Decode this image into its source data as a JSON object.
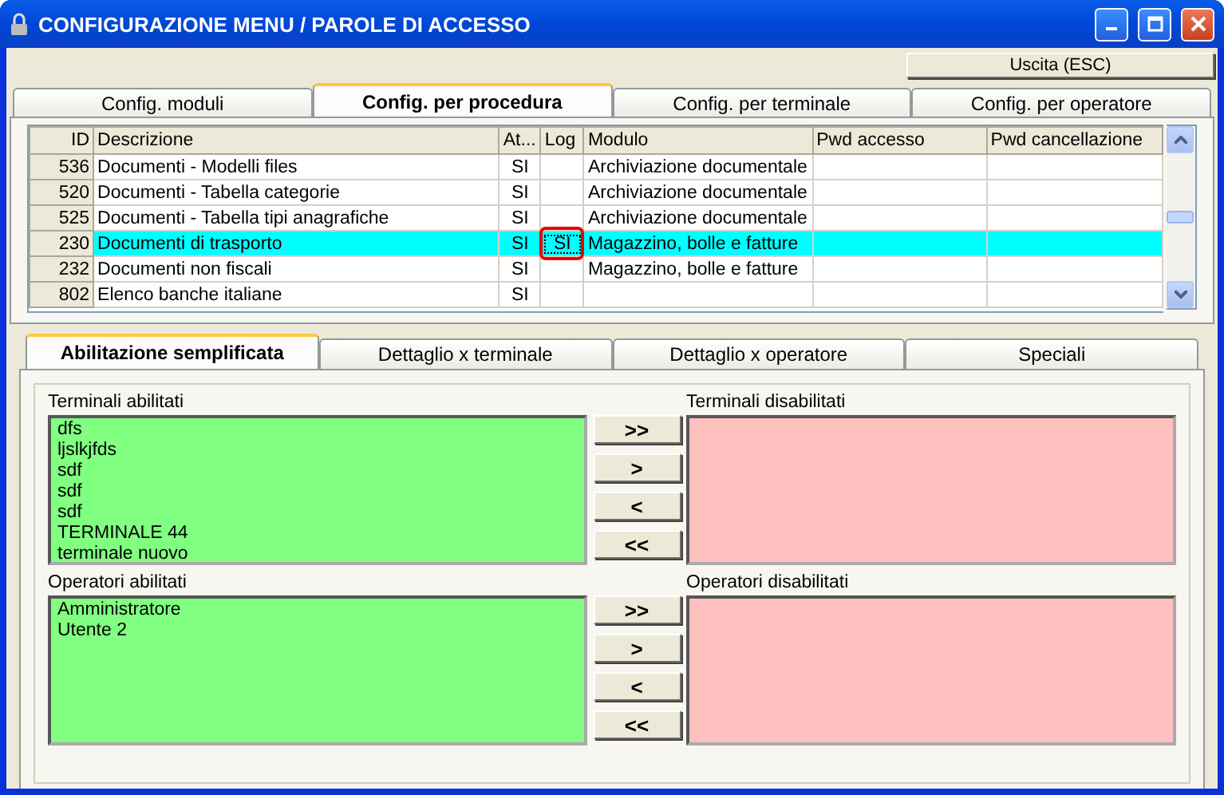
{
  "window": {
    "title": "CONFIGURAZIONE MENU / PAROLE DI ACCESSO"
  },
  "exit_button": "Uscita (ESC)",
  "tabs": [
    {
      "label": "Config. moduli",
      "selected": false
    },
    {
      "label": "Config. per procedura",
      "selected": true
    },
    {
      "label": "Config. per terminale",
      "selected": false
    },
    {
      "label": "Config. per operatore",
      "selected": false
    }
  ],
  "table": {
    "columns": [
      "ID",
      "Descrizione",
      "At...",
      "Log",
      "Modulo",
      "Pwd accesso",
      "Pwd cancellazione"
    ],
    "rows": [
      {
        "id": "536",
        "descrizione": "Documenti - Modelli files",
        "at": "SI",
        "log": "",
        "modulo": "Archiviazione documentale",
        "selected": false,
        "log_highlighted": false
      },
      {
        "id": "520",
        "descrizione": "Documenti - Tabella categorie",
        "at": "SI",
        "log": "",
        "modulo": "Archiviazione documentale",
        "selected": false,
        "log_highlighted": false
      },
      {
        "id": "525",
        "descrizione": "Documenti - Tabella tipi anagrafiche",
        "at": "SI",
        "log": "",
        "modulo": "Archiviazione documentale",
        "selected": false,
        "log_highlighted": false
      },
      {
        "id": "230",
        "descrizione": "Documenti di trasporto",
        "at": "SI",
        "log": "SI",
        "modulo": "Magazzino, bolle e fatture",
        "selected": true,
        "log_highlighted": true
      },
      {
        "id": "232",
        "descrizione": "Documenti non fiscali",
        "at": "SI",
        "log": "",
        "modulo": "Magazzino, bolle e fatture",
        "selected": false,
        "log_highlighted": false
      },
      {
        "id": "802",
        "descrizione": "Elenco banche italiane",
        "at": "SI",
        "log": "",
        "modulo": "",
        "selected": false,
        "log_highlighted": false
      }
    ]
  },
  "sub_tabs": [
    {
      "label": "Abilitazione semplificata",
      "selected": true
    },
    {
      "label": "Dettaglio x terminale",
      "selected": false
    },
    {
      "label": "Dettaglio x operatore",
      "selected": false
    },
    {
      "label": "Speciali",
      "selected": false
    }
  ],
  "sections": [
    {
      "enabled_label": "Terminali abilitati",
      "enabled_items": [
        "dfs",
        "ljslkjfds",
        "sdf",
        "sdf",
        "sdf",
        "TERMINALE 44",
        "terminale nuovo"
      ],
      "disabled_label": "Terminali disabilitati",
      "buttons": [
        ">>",
        ">",
        "<",
        "<<"
      ]
    },
    {
      "enabled_label": "Operatori abilitati",
      "enabled_items": [
        "Amministratore",
        "Utente 2"
      ],
      "disabled_label": "Operatori disabilitati",
      "buttons": [
        ">>",
        ">",
        "<",
        "<<"
      ]
    }
  ]
}
